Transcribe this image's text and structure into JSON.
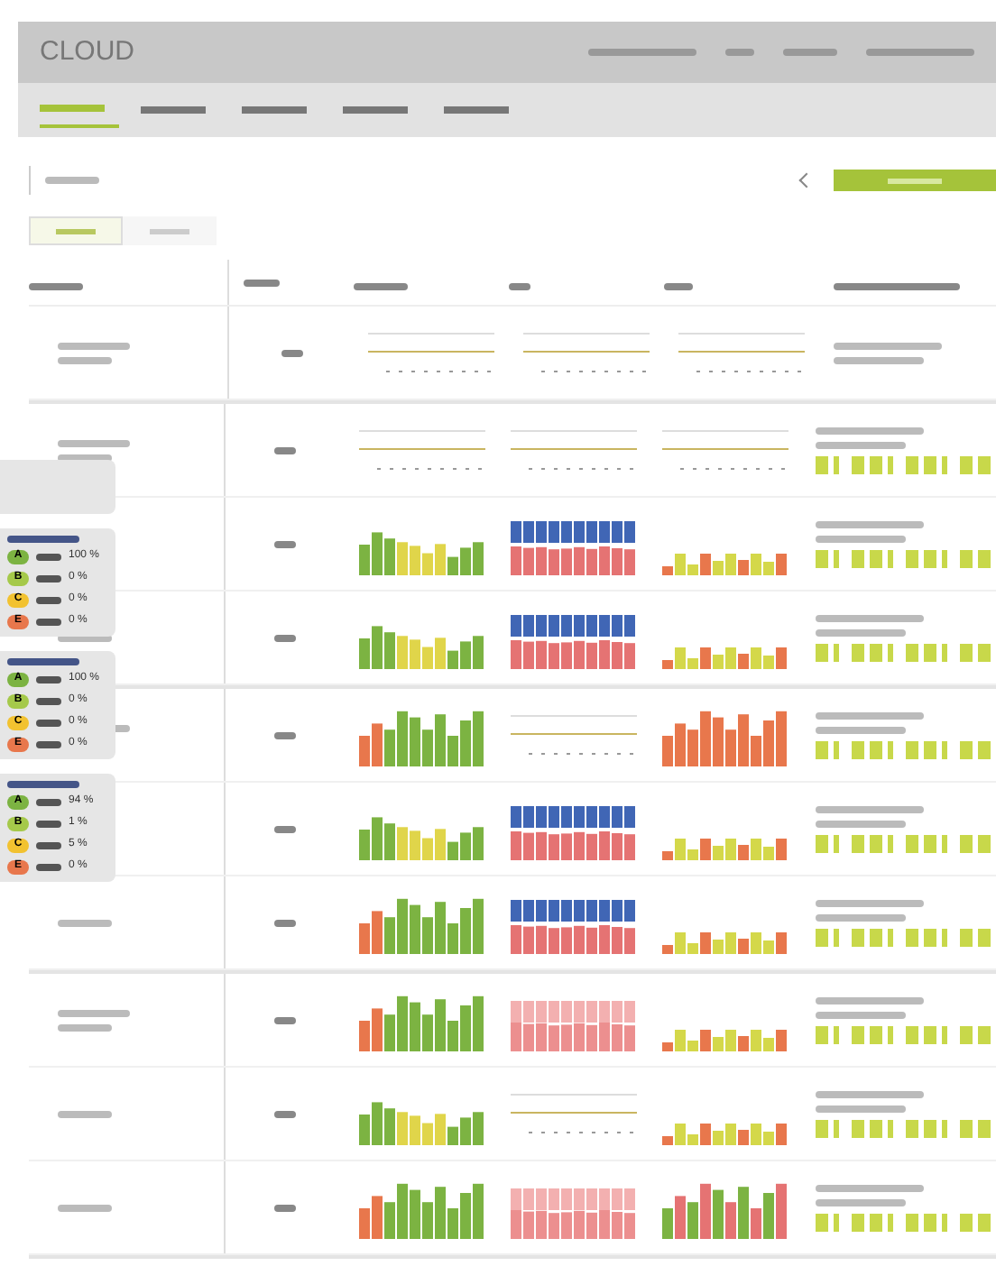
{
  "header": {
    "logo": "CLOUD"
  },
  "nav": [
    {
      "selected": true
    },
    {
      "selected": false
    },
    {
      "selected": false
    },
    {
      "selected": false
    },
    {
      "selected": false
    }
  ],
  "tabs": [
    {
      "selected": true
    },
    {
      "selected": false
    }
  ],
  "groups": [
    {
      "rows": [
        {
          "charts": [
            {
              "kind": "line"
            },
            {
              "kind": "line"
            },
            {
              "kind": "line"
            }
          ],
          "strip": false
        }
      ]
    },
    {
      "rows": [
        {
          "charts": [
            {
              "kind": "line"
            },
            {
              "kind": "line"
            },
            {
              "kind": "line"
            }
          ],
          "strip": true
        },
        {
          "charts": [
            {
              "kind": "traffic"
            },
            {
              "kind": "stacked"
            },
            {
              "kind": "small"
            }
          ],
          "strip": true
        },
        {
          "charts": [
            {
              "kind": "traffic"
            },
            {
              "kind": "stacked"
            },
            {
              "kind": "small"
            }
          ],
          "strip": true
        }
      ]
    },
    {
      "rows": [
        {
          "charts": [
            {
              "kind": "green"
            },
            {
              "kind": "line"
            },
            {
              "kind": "orange"
            }
          ],
          "strip": true
        },
        {
          "charts": [
            {
              "kind": "traffic"
            },
            {
              "kind": "stacked"
            },
            {
              "kind": "small"
            }
          ],
          "strip": true
        },
        {
          "charts": [
            {
              "kind": "green"
            },
            {
              "kind": "stacked"
            },
            {
              "kind": "small"
            }
          ],
          "strip": true
        }
      ]
    },
    {
      "rows": [
        {
          "charts": [
            {
              "kind": "green"
            },
            {
              "kind": "pink"
            },
            {
              "kind": "small"
            }
          ],
          "strip": true
        },
        {
          "charts": [
            {
              "kind": "traffic"
            },
            {
              "kind": "line"
            },
            {
              "kind": "small"
            }
          ],
          "strip": true
        },
        {
          "charts": [
            {
              "kind": "green"
            },
            {
              "kind": "pink"
            },
            {
              "kind": "mixed"
            }
          ],
          "strip": true
        }
      ]
    }
  ],
  "legends": [
    {
      "items": [
        {
          "badge": "A",
          "color": "#7cb342",
          "value": "100 %"
        },
        {
          "badge": "B",
          "color": "#a5c94a",
          "value": "0 %"
        },
        {
          "badge": "C",
          "color": "#f2c230",
          "value": "0 %"
        },
        {
          "badge": "E",
          "color": "#e8774c",
          "value": "0 %"
        }
      ]
    },
    {
      "items": [
        {
          "badge": "A",
          "color": "#7cb342",
          "value": "100 %"
        },
        {
          "badge": "B",
          "color": "#a5c94a",
          "value": "0 %"
        },
        {
          "badge": "C",
          "color": "#f2c230",
          "value": "0 %"
        },
        {
          "badge": "E",
          "color": "#e8774c",
          "value": "0 %"
        }
      ]
    },
    {
      "items": [
        {
          "badge": "A",
          "color": "#7cb342",
          "value": "94 %"
        },
        {
          "badge": "B",
          "color": "#a5c94a",
          "value": "1 %"
        },
        {
          "badge": "C",
          "color": "#f2c230",
          "value": "5 %"
        },
        {
          "badge": "E",
          "color": "#e8774c",
          "value": "0 %"
        }
      ]
    }
  ]
}
